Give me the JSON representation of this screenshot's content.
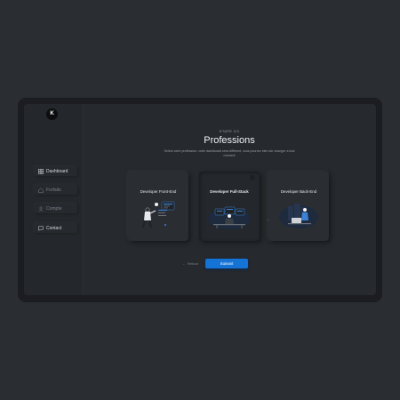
{
  "app": {
    "logo_text": "K"
  },
  "sidebar": {
    "items": [
      {
        "label": "Dashboard",
        "icon": "grid-icon",
        "active": true
      },
      {
        "label": "Forfaits",
        "icon": "home-icon",
        "active": false
      },
      {
        "label": "Compte",
        "icon": "user-icon",
        "active": false
      },
      {
        "label": "Contact",
        "icon": "chat-icon",
        "active": false
      }
    ]
  },
  "main": {
    "step": "ETAPE 2/3",
    "title": "Professions",
    "subtitle": "Select votre profession: votre dashboard sera différent, vous pourrez bien sûr changer à tout moment",
    "cards": [
      {
        "label": "Developer Front-End",
        "selected": false
      },
      {
        "label": "Developer Full-Stack",
        "selected": true
      },
      {
        "label": "Developer Back-End",
        "selected": false
      }
    ],
    "back_label": "Retour",
    "next_label": "Suivant"
  },
  "colors": {
    "accent": "#1573d6",
    "background": "#2a2d32",
    "panel": "#26292d"
  }
}
